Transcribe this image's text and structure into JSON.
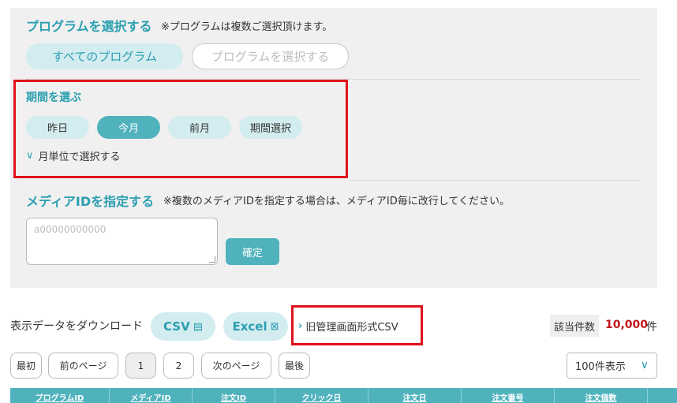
{
  "program": {
    "title": "プログラムを選択する",
    "note": "※プログラムは複数ご選択頂けます。",
    "all_label": "すべてのプログラム",
    "select_label": "プログラムを選択する"
  },
  "period": {
    "title": "期間を選ぶ",
    "options": [
      "昨日",
      "今月",
      "前月",
      "期間選択"
    ],
    "selected": "今月",
    "monthly_toggle": "月単位で選択する"
  },
  "media": {
    "title": "メディアIDを指定する",
    "note": "※複数のメディアIDを指定する場合は、メディアID毎に改行してください。",
    "placeholder": "a00000000000",
    "confirm_label": "確定"
  },
  "download": {
    "label": "表示データをダウンロード",
    "csv_label": "CSV",
    "excel_label": "Excel",
    "legacy_label": "旧管理画面形式CSV"
  },
  "results": {
    "count_label": "該当件数",
    "count_value": "10,000",
    "count_unit": "件"
  },
  "pagination": {
    "first": "最初",
    "prev": "前のページ",
    "pages": [
      "1",
      "2"
    ],
    "current": "1",
    "next": "次のページ",
    "last": "最後",
    "per_page": "100件表示"
  },
  "table": {
    "headers": [
      "プログラムID",
      "メディアID",
      "注文ID",
      "クリック日",
      "注文日",
      "注文番号",
      "注文個数",
      ""
    ]
  },
  "colors": {
    "accent": "#2a9fb0",
    "button_fill": "#4fb2bd",
    "pill_light": "#d3ecf0",
    "highlight_red": "#e0121b",
    "count_red": "#c0141b"
  }
}
